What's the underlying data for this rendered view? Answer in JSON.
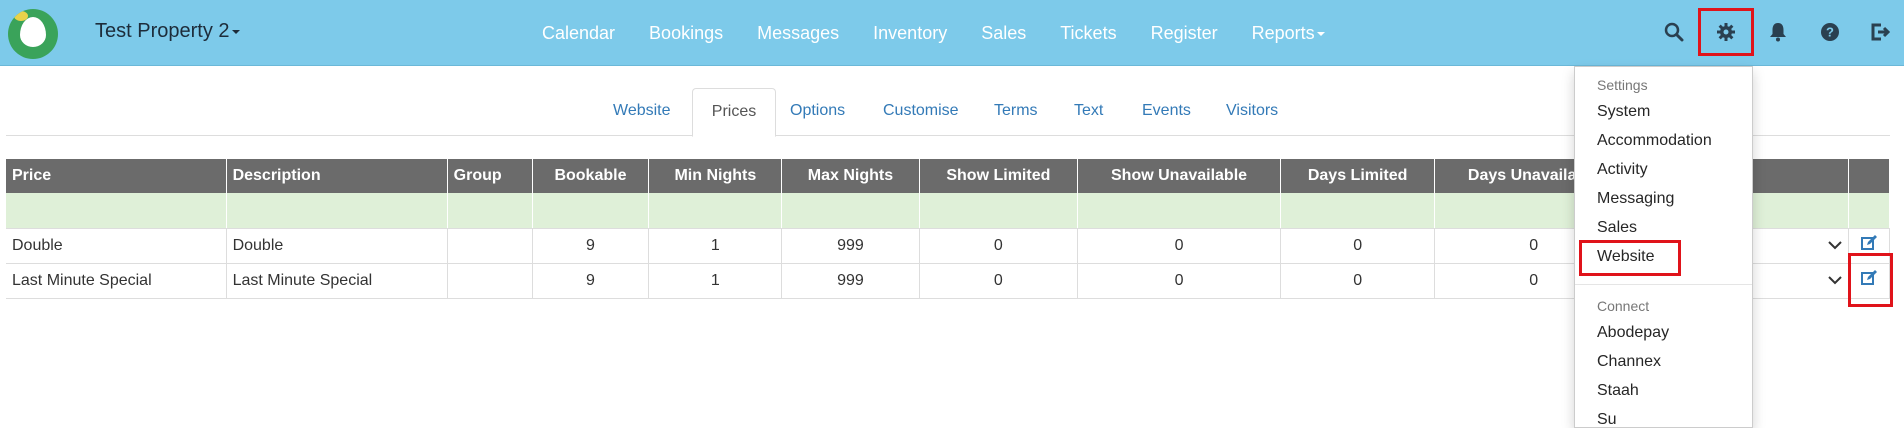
{
  "navbar": {
    "property_name": "Test Property 2",
    "menu": [
      "Calendar",
      "Bookings",
      "Messages",
      "Inventory",
      "Sales",
      "Tickets",
      "Register",
      "Reports"
    ],
    "icons": [
      "search-icon",
      "gear-icon",
      "bell-icon",
      "help-icon",
      "logout-icon"
    ]
  },
  "tabs": [
    "Website",
    "Prices",
    "Options",
    "Customise",
    "Terms",
    "Text",
    "Events",
    "Visitors"
  ],
  "active_tab": "Prices",
  "table": {
    "headers": [
      "Price",
      "Description",
      "Group",
      "Bookable",
      "Min Nights",
      "Max Nights",
      "Show Limited",
      "Show Unavailable",
      "Days Limited",
      "Days Unavailable"
    ],
    "rows": [
      [
        "Double",
        "Double",
        "",
        "9",
        "1",
        "999",
        "0",
        "0",
        "0",
        "0"
      ],
      [
        "Last Minute Special",
        "Last Minute Special",
        "",
        "9",
        "1",
        "999",
        "0",
        "0",
        "0",
        "0"
      ]
    ]
  },
  "settings_menu": {
    "settings_header": "Settings",
    "settings_items": [
      "System",
      "Accommodation",
      "Activity",
      "Messaging",
      "Sales",
      "Website"
    ],
    "connect_header": "Connect",
    "connect_items": [
      "Abodepay",
      "Channex",
      "Staah",
      "Su"
    ]
  },
  "colors": {
    "navbar": "#7dcaea",
    "table_header": "#6b6b6b",
    "filter_row": "#dff0d8",
    "link": "#337ab7",
    "highlight": "#e0131a"
  }
}
